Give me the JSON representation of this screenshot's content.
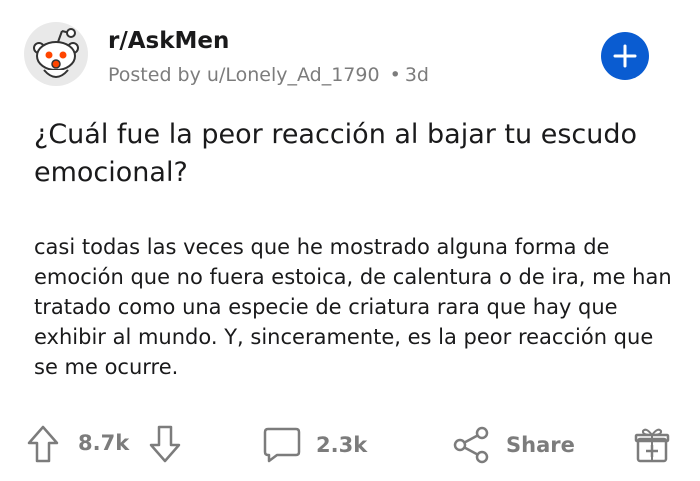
{
  "post": {
    "subreddit": "r/AskMen",
    "posted_by_prefix": "Posted by",
    "author": "u/Lonely_Ad_1790",
    "separator": "•",
    "age": "3d",
    "title": "¿Cuál fue la peor reacción al bajar tu escudo emocional?",
    "body": "casi todas las veces que he mostrado alguna forma de emoción que no fuera estoica, de calentura o de ira, me han tratado como una especie de criatura rara que hay que exhibir al mundo. Y, sinceramente, es la peor reacción que se me ocurre."
  },
  "actions": {
    "upvotes": "8.7k",
    "comments": "2.3k",
    "share_label": "Share"
  },
  "icons": {
    "avatar": "snoo-avatar-icon",
    "join": "plus-icon",
    "upvote": "upvote-arrow-icon",
    "downvote": "downvote-arrow-icon",
    "comment": "comment-bubble-icon",
    "share": "share-icon",
    "award": "gift-award-icon"
  },
  "colors": {
    "accent_blue": "#0a5cd1",
    "muted_gray": "#7c7c7c",
    "text": "#1a1a1b",
    "snoo_red": "#ff4500"
  }
}
